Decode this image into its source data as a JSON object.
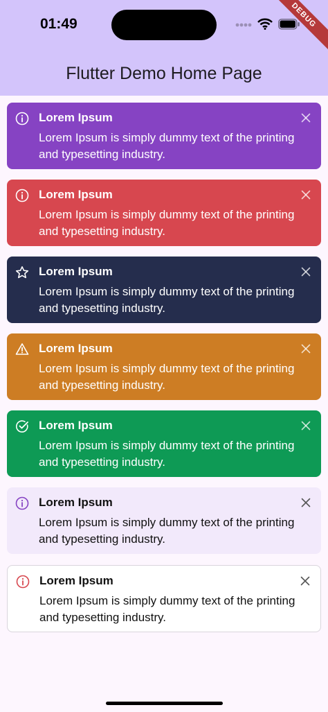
{
  "status": {
    "time": "01:49",
    "debug_label": "DEBUG"
  },
  "app": {
    "title": "Flutter Demo Home Page"
  },
  "alerts": [
    {
      "variant": "info-purple",
      "icon": "info-circle-icon",
      "bg": "#8643c3",
      "fg": "#ffffff",
      "title": "Lorem Ipsum",
      "body": "Lorem Ipsum is simply dummy text of the printing and typesetting industry."
    },
    {
      "variant": "error",
      "icon": "info-circle-icon",
      "bg": "#d7474f",
      "fg": "#ffffff",
      "title": "Lorem Ipsum",
      "body": "Lorem Ipsum is simply dummy text of the printing and typesetting industry."
    },
    {
      "variant": "dark",
      "icon": "star-icon",
      "bg": "#252d4d",
      "fg": "#ffffff",
      "title": "Lorem Ipsum",
      "body": "Lorem Ipsum is simply dummy text of the printing and typesetting industry."
    },
    {
      "variant": "warning",
      "icon": "warning-triangle-icon",
      "bg": "#cd7d24",
      "fg": "#ffffff",
      "title": "Lorem Ipsum",
      "body": "Lorem Ipsum is simply dummy text of the printing and typesetting industry."
    },
    {
      "variant": "success",
      "icon": "check-circle-icon",
      "bg": "#0e9a55",
      "fg": "#ffffff",
      "title": "Lorem Ipsum",
      "body": "Lorem Ipsum is simply dummy text of the printing and typesetting industry."
    },
    {
      "variant": "info-light",
      "icon": "info-circle-icon",
      "bg": "#f2e9fb",
      "fg": "#111111",
      "icon_color": "#8643c3",
      "title": "Lorem Ipsum",
      "body": "Lorem Ipsum is simply dummy text of the printing and typesetting industry."
    },
    {
      "variant": "error-outline",
      "icon": "info-circle-icon",
      "bg": "#ffffff",
      "fg": "#111111",
      "icon_color": "#d7474f",
      "title": "Lorem Ipsum",
      "body": "Lorem Ipsum is simply dummy text of the printing and typesetting industry."
    }
  ]
}
